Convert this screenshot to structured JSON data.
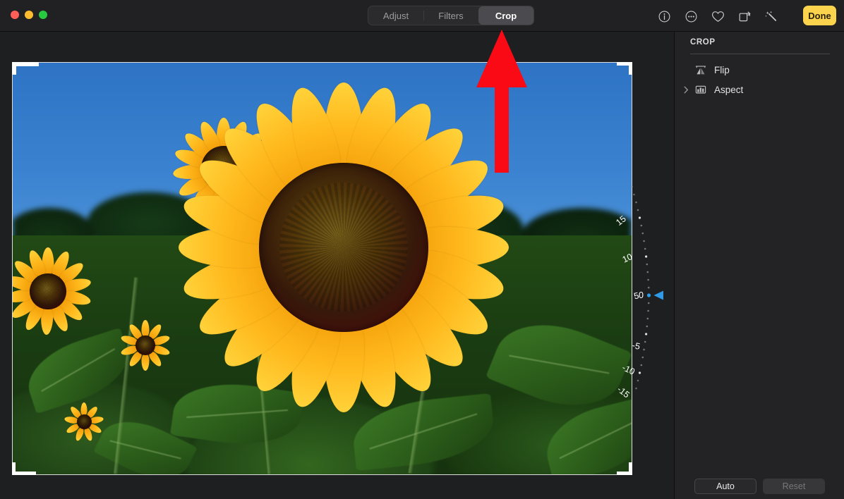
{
  "window": {
    "traffic_lights": [
      {
        "name": "close",
        "color": "#ff5f57"
      },
      {
        "name": "minimize",
        "color": "#febc2e"
      },
      {
        "name": "maximize",
        "color": "#28c840"
      }
    ]
  },
  "toolbar": {
    "segments": [
      {
        "label": "Adjust",
        "selected": false
      },
      {
        "label": "Filters",
        "selected": false
      },
      {
        "label": "Crop",
        "selected": true
      }
    ],
    "icons": [
      {
        "name": "info-icon",
        "glyph": "info"
      },
      {
        "name": "more-options-icon",
        "glyph": "ellipsis"
      },
      {
        "name": "favorite-icon",
        "glyph": "heart"
      },
      {
        "name": "rotate-icon",
        "glyph": "rotate"
      },
      {
        "name": "auto-enhance-icon",
        "glyph": "magic-wand"
      }
    ],
    "done_label": "Done",
    "done_color": "#fcd34d"
  },
  "sidebar": {
    "title": "CROP",
    "rows": [
      {
        "label": "Flip",
        "icon": "flip-icon",
        "has_disclosure": false
      },
      {
        "label": "Aspect",
        "icon": "aspect-icon",
        "has_disclosure": true
      }
    ],
    "actions": [
      {
        "label": "Auto",
        "enabled": true
      },
      {
        "label": "Reset",
        "enabled": false
      }
    ]
  },
  "straighten_dial": {
    "name": "straighten-rotation-dial",
    "value": 0,
    "unit": "degrees",
    "indicator_color": "#2f9ae6",
    "tick_labels": [
      "15",
      "10",
      "5",
      "0",
      "-5",
      "-10",
      "-15"
    ],
    "range": [
      -15,
      15
    ]
  },
  "photo": {
    "subject": "sunflower field",
    "crop_handles": [
      "top-left",
      "top-right",
      "bottom-left",
      "bottom-right"
    ]
  },
  "annotation": {
    "name": "red-arrow-pointing-to-crop-tab",
    "color": "#fa0a14",
    "points_to": "Crop"
  }
}
